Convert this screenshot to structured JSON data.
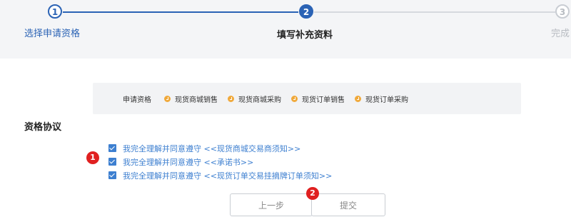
{
  "stepper": {
    "steps": [
      {
        "number": "1",
        "label": "选择申请资格"
      },
      {
        "number": "2",
        "label": "填写补充资料"
      },
      {
        "number": "3",
        "label": "完成"
      }
    ]
  },
  "qualification": {
    "label": "申请资格",
    "items": [
      "现货商城销售",
      "现货商城采购",
      "现货订单销售",
      "现货订单采购"
    ]
  },
  "agreement_section": {
    "title": "资格协议",
    "items": [
      "我完全理解并同意遵守 <<现货商城交易商须知>>",
      "我完全理解并同意遵守 <<承诺书>>",
      "我完全理解并同意遵守 <<现货订单交易挂摘牌订单须知>>"
    ]
  },
  "badges": [
    "1",
    "2"
  ],
  "buttons": {
    "prev": "上一步",
    "submit": "提交"
  },
  "colors": {
    "accent": "#2b63b5",
    "checkbox": "#3d7fd0",
    "badge": "#e02020",
    "qual_dot": "#f0a93b"
  }
}
